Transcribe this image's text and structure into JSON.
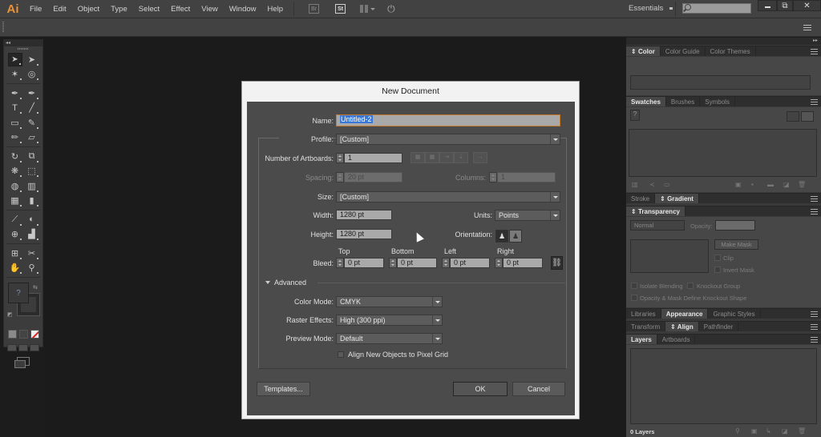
{
  "app": {
    "logo": "Ai",
    "menu": [
      "File",
      "Edit",
      "Object",
      "Type",
      "Select",
      "Effect",
      "View",
      "Window",
      "Help"
    ],
    "toolbar_icons": [
      "bridge-icon",
      "stock-icon",
      "arrange-documents-icon",
      "gpu-performance-icon"
    ],
    "bridge_label": "Br",
    "stock_label": "St",
    "workspace": "Essentials",
    "search_placeholder": "",
    "window_controls": {
      "minimize": "",
      "restore": "⧉",
      "close": "✕"
    }
  },
  "tools": {
    "header": "◂◂",
    "rows": [
      [
        "selection-tool",
        "direct-selection-tool"
      ],
      [
        "magic-wand-tool",
        "lasso-tool"
      ],
      [
        "pen-tool",
        "curvature-tool"
      ],
      [
        "type-tool",
        "line-segment-tool"
      ],
      [
        "rectangle-tool",
        "paintbrush-tool"
      ],
      [
        "pencil-tool",
        "eraser-tool"
      ],
      [
        "rotate-tool",
        "scale-tool"
      ],
      [
        "warp-tool",
        "free-transform-tool"
      ],
      [
        "shape-builder-tool",
        "perspective-grid-tool"
      ],
      [
        "mesh-tool",
        "gradient-tool"
      ],
      [
        "eyedropper-tool",
        "blend-tool"
      ],
      [
        "symbol-sprayer-tool",
        "column-graph-tool"
      ],
      [
        "artboard-tool",
        "slice-tool"
      ],
      [
        "hand-tool",
        "zoom-tool"
      ]
    ],
    "glyphs": [
      [
        "➤",
        "➤"
      ],
      [
        "✶",
        "◎"
      ],
      [
        "✒",
        "✒"
      ],
      [
        "T",
        "╱"
      ],
      [
        "▭",
        "✎"
      ],
      [
        "✏",
        "▱"
      ],
      [
        "↻",
        "⧉"
      ],
      [
        "❋",
        "⬚"
      ],
      [
        "◍",
        "▥"
      ],
      [
        "▦",
        "▮"
      ],
      [
        "⟋",
        "◐"
      ],
      [
        "⊕",
        "▟"
      ],
      [
        "⊞",
        "✂"
      ],
      [
        "✋",
        "⚲"
      ]
    ],
    "fill_label": "?",
    "swap_label": "⇆",
    "default_label": "◩"
  },
  "dialog": {
    "title": "New Document",
    "name_label": "Name:",
    "name_value": "Untitled-2",
    "profile_label": "Profile:",
    "profile_value": "[Custom]",
    "artboards_label": "Number of Artboards:",
    "artboards_value": "1",
    "artboard_layout_icons": [
      "grid-by-row-icon",
      "grid-by-column-icon",
      "arrange-by-row-icon",
      "arrange-by-column-icon",
      "right-to-left-icon"
    ],
    "artboard_layout_glyphs": [
      "▦",
      "▦",
      "⇢",
      "⇣",
      "→"
    ],
    "spacing_label": "Spacing:",
    "spacing_value": "20 pt",
    "columns_label": "Columns:",
    "columns_value": "1",
    "size_label": "Size:",
    "size_value": "[Custom]",
    "width_label": "Width:",
    "width_value": "1280 pt",
    "units_label": "Units:",
    "units_value": "Points",
    "height_label": "Height:",
    "height_value": "1280 pt",
    "orientation_label": "Orientation:",
    "orientation_portrait": "♟",
    "orientation_landscape": "♟",
    "bleed_label": "Bleed:",
    "bleed": [
      {
        "side": "Top",
        "value": "0 pt"
      },
      {
        "side": "Bottom",
        "value": "0 pt"
      },
      {
        "side": "Left",
        "value": "0 pt"
      },
      {
        "side": "Right",
        "value": "0 pt"
      }
    ],
    "link_glyph": "⛓",
    "advanced_label": "Advanced",
    "color_mode_label": "Color Mode:",
    "color_mode_value": "CMYK",
    "raster_label": "Raster Effects:",
    "raster_value": "High (300 ppi)",
    "preview_label": "Preview Mode:",
    "preview_value": "Default",
    "pixel_grid_label": "Align New Objects to Pixel Grid",
    "pixel_grid_checked": false,
    "templates_button": "Templates...",
    "ok_button": "OK",
    "cancel_button": "Cancel",
    "accent_color": "#3a78d8",
    "focus_color": "#c57a2e"
  },
  "dock": {
    "collapse_label": "▸▸",
    "color_tabs": [
      "Color",
      "Color Guide",
      "Color Themes"
    ],
    "swatch_tabs": [
      "Swatches",
      "Brushes",
      "Symbols"
    ],
    "swatch_footer_icons": [
      "swatch-libraries-icon",
      "show-kinds-icon",
      "swatch-options-icon",
      "new-color-group-icon",
      "new-swatch-icon",
      "delete-swatch-icon"
    ],
    "stroke_tabs": [
      "Stroke",
      "Gradient"
    ],
    "transparency_tabs": [
      "Transparency"
    ],
    "blend_mode": "Normal",
    "opacity_label": "Opacity:",
    "opacity_value": "",
    "make_mask": "Make Mask",
    "clip_label": "Clip",
    "invert_mask_label": "Invert Mask",
    "isolate_blending": "Isolate Blending",
    "knockout_group": "Knockout Group",
    "opacity_mask_knockout": "Opacity & Mask Define Knockout Shape",
    "appearance_tabs": [
      "Libraries",
      "Appearance",
      "Graphic Styles"
    ],
    "align_tabs": [
      "Transform",
      "Align",
      "Pathfinder"
    ],
    "layers_tabs": [
      "Layers",
      "Artboards"
    ],
    "layers_count": "0 Layers"
  }
}
